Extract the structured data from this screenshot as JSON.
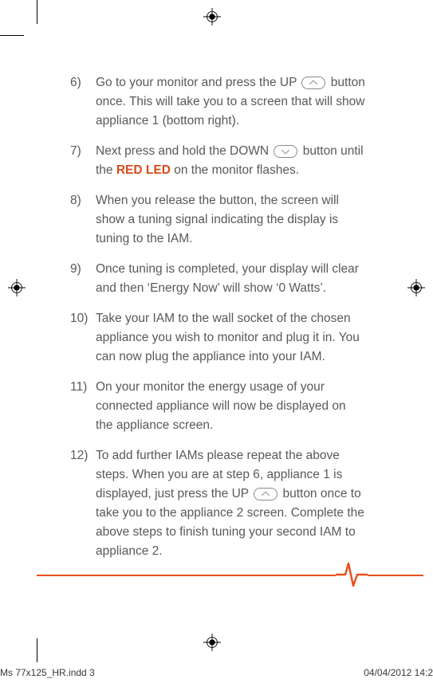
{
  "steps": [
    {
      "num": "6)",
      "pre": "Go to your monitor and press the UP ",
      "icon": "up",
      "post": " button once. This will take you to a screen that will show appliance 1 (bottom right)."
    },
    {
      "num": "7)",
      "pre": "Next press and hold the DOWN ",
      "icon": "down",
      "post_a": " button until the ",
      "highlight": "RED LED",
      "post_b": " on the monitor flashes."
    },
    {
      "num": "8)",
      "text": "When you release the button, the screen will show a tuning signal indicating the display is tuning to the IAM."
    },
    {
      "num": "9)",
      "text": "Once tuning is completed, your display will clear and then ‘Energy Now’ will show ‘0 Watts’."
    },
    {
      "num": "10)",
      "text": "Take your IAM to the wall socket of the chosen appliance you wish to monitor and plug it in. You can now plug the appliance into your IAM."
    },
    {
      "num": "11)",
      "text": "On your monitor the energy usage of your connected appliance will now be displayed on the appliance screen."
    },
    {
      "num": "12)",
      "pre": "To add further IAMs please repeat the above steps. When you are at step 6, appliance 1 is displayed, just press the UP ",
      "icon": "up",
      "post": " button once to take you to the appliance 2 screen. Complete the above steps to finish tuning your second IAM to appliance 2."
    }
  ],
  "footer": {
    "left": "Ms 77x125_HR.indd   3",
    "right": "04/04/2012   14:2"
  }
}
